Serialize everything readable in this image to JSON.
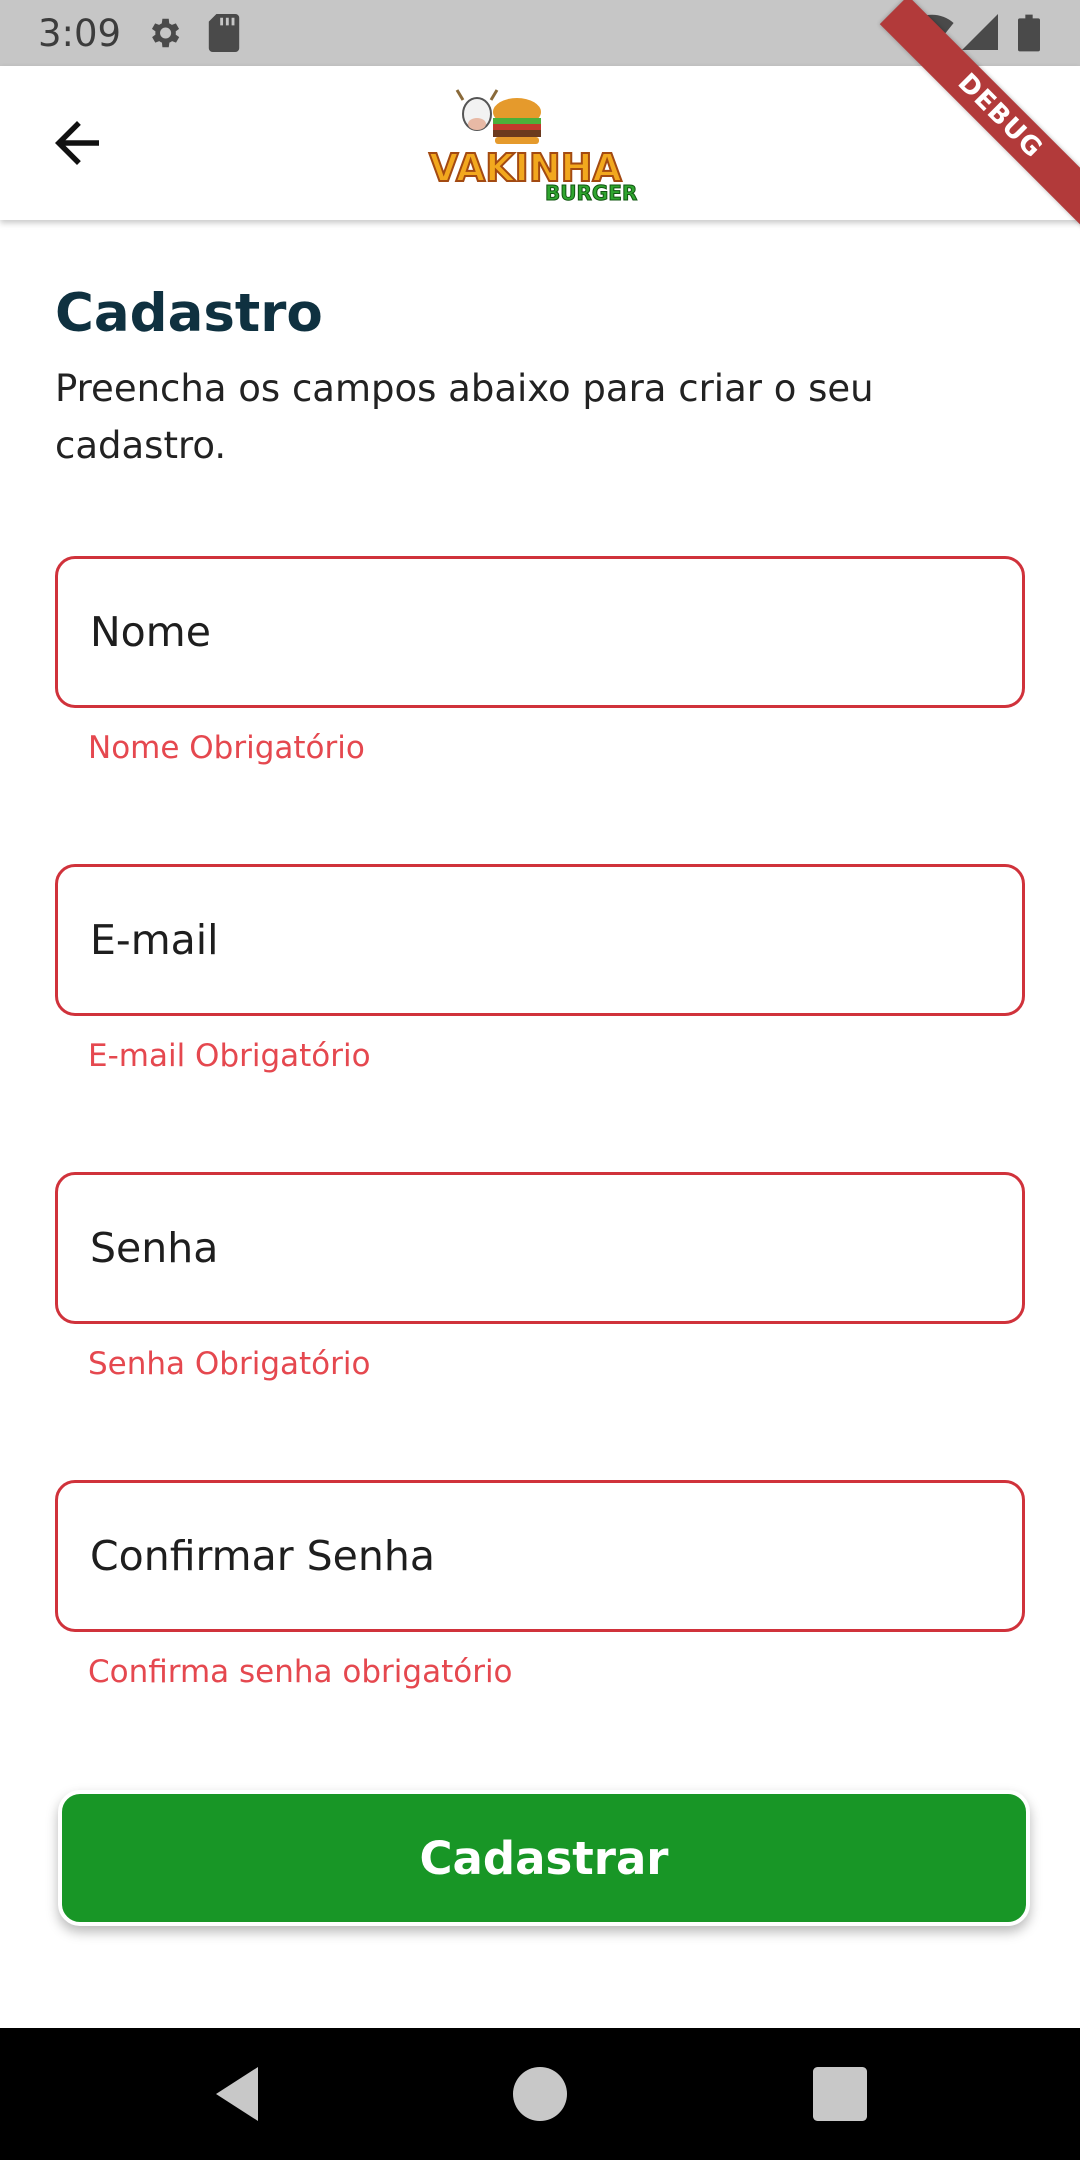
{
  "status_bar": {
    "time": "3:09",
    "icons": [
      "settings-icon",
      "sd-card-icon",
      "wifi-icon",
      "signal-icon",
      "battery-icon"
    ]
  },
  "app_bar": {
    "back_icon": "arrow-back-icon",
    "logo_text_top": "VAKINHA",
    "logo_text_bottom": "BURGER",
    "debug_label": "DEBUG"
  },
  "page": {
    "title": "Cadastro",
    "subtitle": "Preencha os campos abaixo para criar o seu cadastro."
  },
  "form": {
    "fields": [
      {
        "label": "Nome",
        "error": "Nome Obrigatório"
      },
      {
        "label": "E-mail",
        "error": "E-mail Obrigatório"
      },
      {
        "label": "Senha",
        "error": "Senha Obrigatório"
      },
      {
        "label": "Confirmar Senha",
        "error": "Confirma senha obrigatório"
      }
    ],
    "submit_label": "Cadastrar"
  },
  "colors": {
    "error": "#e5484f",
    "border_error": "#d0323b",
    "primary": "#189626",
    "title": "#0f3140"
  },
  "nav_bar": {
    "icons": [
      "back-triangle-icon",
      "home-circle-icon",
      "recents-square-icon"
    ]
  }
}
